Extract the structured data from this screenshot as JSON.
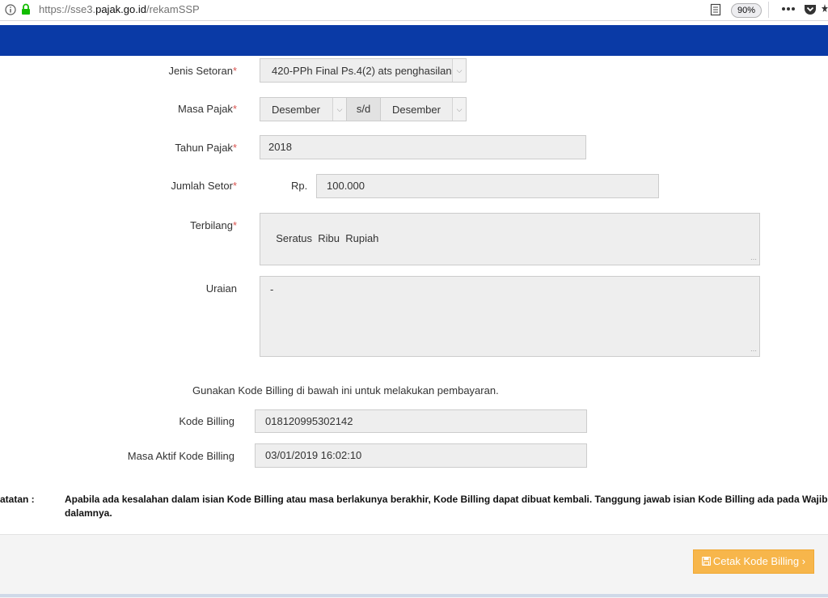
{
  "browser": {
    "url_prefix": "https://sse3.",
    "url_host": "pajak.go.id",
    "url_path": "/rekamSSP",
    "zoom": "90%"
  },
  "form": {
    "jenis_setoran": {
      "label": "Jenis Setoran",
      "value": "420-PPh Final Ps.4(2) ats penghasilan"
    },
    "masa_pajak": {
      "label": "Masa Pajak",
      "from": "Desember",
      "separator": "s/d",
      "to": "Desember"
    },
    "tahun_pajak": {
      "label": "Tahun Pajak",
      "value": "2018"
    },
    "jumlah_setor": {
      "label": "Jumlah Setor",
      "currency": "Rp.",
      "value": "100.000"
    },
    "terbilang": {
      "label": "Terbilang",
      "value": "Seratus  Ribu  Rupiah"
    },
    "uraian": {
      "label": "Uraian",
      "value": "-"
    },
    "required_mark": "*"
  },
  "billing": {
    "instruction": "Gunakan Kode Billing di bawah ini untuk melakukan pembayaran.",
    "kode_label": "Kode Billing",
    "kode_value": "018120995302142",
    "masa_label": "Masa Aktif Kode Billing",
    "masa_value": "03/01/2019 16:02:10"
  },
  "note": {
    "label": "atatan :",
    "line1": "Apabila ada kesalahan dalam isian Kode Billing atau masa berlakunya berakhir, Kode Billing dapat dibuat kembali. Tanggung jawab isian Kode Billing ada pada Wajib",
    "line2": "dalamnya."
  },
  "footer": {
    "cetak_label": "Cetak Kode Billing",
    "cetak_icon": "floppy-icon",
    "chevron": "›"
  },
  "colors": {
    "header_blue": "#0a3aa6",
    "button_orange": "#f7b64b",
    "required_red": "#d9534f"
  }
}
